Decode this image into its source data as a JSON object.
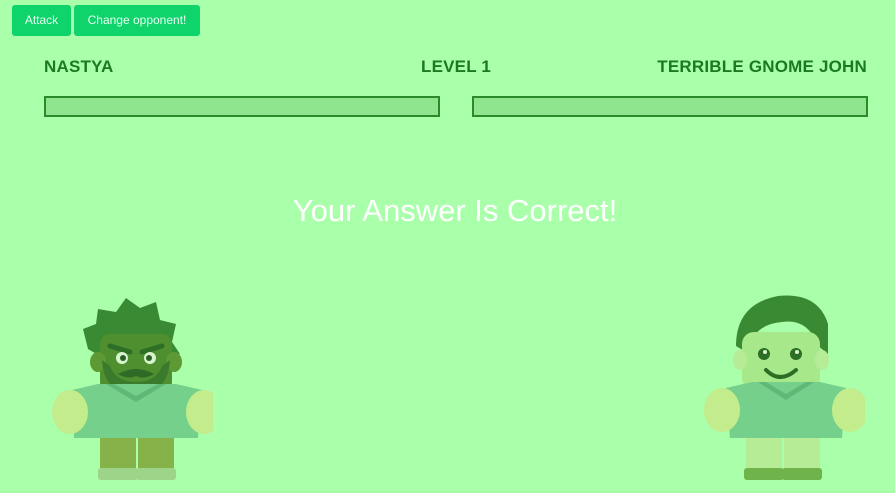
{
  "toolbar": {
    "attack_label": "Attack",
    "change_opponent_label": "Change opponent!"
  },
  "header": {
    "player_name": "NASTYA",
    "level": "LEVEL 1",
    "opponent_name": "TERRIBLE GNOME JOHN"
  },
  "health": {
    "player": 1.0,
    "opponent": 1.0
  },
  "message": "Your Answer Is Correct!",
  "characters": {
    "player_icon": "angry-bearded-gnome",
    "opponent_icon": "smiling-gnome"
  },
  "colors": {
    "background": "#aaffaa",
    "button": "#0fd36b",
    "text": "#1a7a1f",
    "hp_border": "#2a8a2a",
    "hp_fill": "#8ee58e"
  }
}
